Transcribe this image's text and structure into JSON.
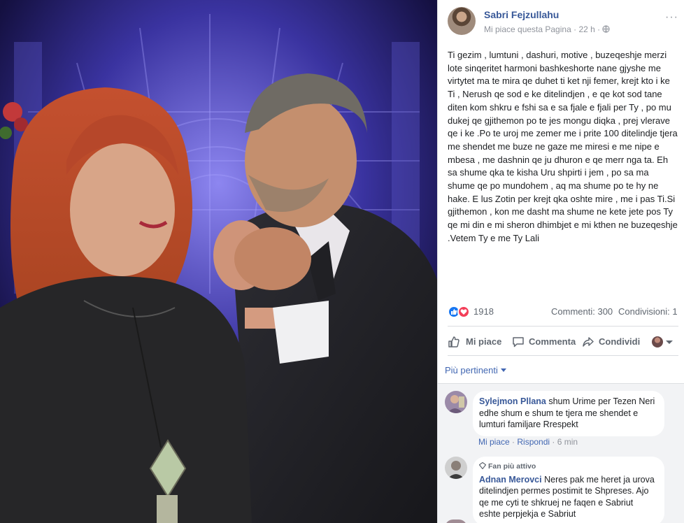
{
  "post": {
    "page_name": "Sabri Fejzullahu",
    "like_page": "Mi piace questa Pagina",
    "separator": "·",
    "time": "22 h",
    "more": "···",
    "text": "Ti gezim , lumtuni , dashuri, motive , buzeqeshje merzi lote sinqeritet harmoni bashkeshorte nane gjyshe me virtytet ma te mira qe duhet ti ket nji femer, krejt kto i ke Ti , Nerush qe sod e ke ditelindjen , e qe kot sod tane diten kom shkru e fshi sa e sa fjale e fjali per Ty , po mu dukej qe gjithemon po te jes mongu diqka , prej vlerave qe i ke .Po te uroj me zemer me i prite 100 ditelindje tjera me shendet me buze ne gaze me miresi e me nipe e mbesa , me dashnin qe ju dhuron e qe merr nga ta. Eh sa shume qka te kisha Uru shpirti i jem , po sa ma shume qe po mundohem , aq ma shume po te hy ne hake. E lus Zotin per krejt qka oshte mire , me i pas Ti.Si gjithemon , kon me dasht ma shume ne kete jete pos Ty qe mi din e mi sheron dhimbjet e mi kthen ne buzeqeshje .Vetem Ty e me Ty Lali"
  },
  "stats": {
    "reactions": "1918",
    "comments": "Commenti: 300",
    "shares": "Condivisioni: 1"
  },
  "actions": {
    "like": "Mi piace",
    "comment": "Commenta",
    "share": "Condividi"
  },
  "relevance": "Più pertinenti",
  "comments": [
    {
      "author": "Sylejmon Pllana",
      "text": "shum Urime per Tezen Neri edhe shum e shum te tjera me shendet e lumturi familjare Rrespekt",
      "like": "Mi piace",
      "reply": "Rispondi",
      "time": "6 min"
    },
    {
      "badge": "Fan più attivo",
      "author": "Adnan Merovci",
      "text": "Neres pak me heret ja urova ditelindjen permes postimit te Shpreses. Ajo qe me cyti te shkruej ne faqen e Sabriut eshte perpjekja e Sabriut"
    }
  ],
  "colors": {
    "link": "#385898",
    "like_reaction": "#1877f2",
    "love_reaction": "#f33e58",
    "comment_bg": "#f2f3f5"
  },
  "icons": [
    "globe-icon",
    "thumbs-up-icon",
    "comment-icon",
    "share-icon",
    "heart-icon",
    "caret-down-icon",
    "fan-badge-icon"
  ]
}
